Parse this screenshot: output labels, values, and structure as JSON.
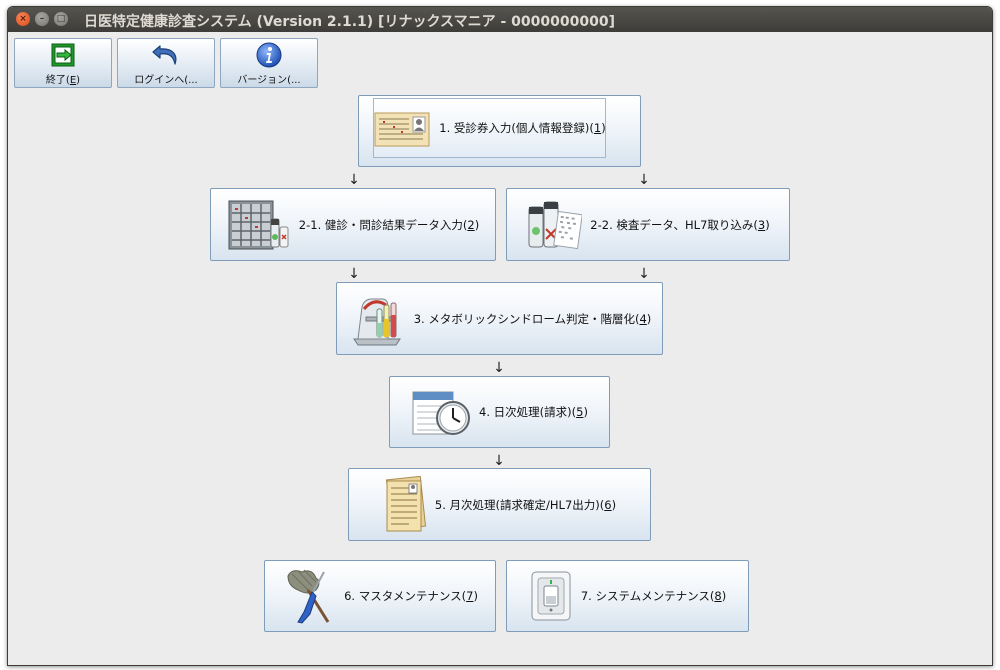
{
  "window": {
    "title": "日医特定健康診査システム (Version 2.1.1) [リナックスマニア - 0000000000]",
    "close_glyph": "×",
    "min_glyph": "–",
    "max_glyph": "□"
  },
  "toolbar": {
    "exit_label": "終了(",
    "exit_key": "E",
    "exit_tail": ")",
    "login_label": "ログインへ(...",
    "version_label": "バージョン(..."
  },
  "menu": {
    "item1": {
      "text": "1. 受診券入力(個人情報登録)(",
      "key": "1",
      "tail": ")"
    },
    "item2_1": {
      "text": "2-1. 健診・問診結果データ入力(",
      "key": "2",
      "tail": ")"
    },
    "item2_2": {
      "text": "2-2. 検査データ、HL7取り込み(",
      "key": "3",
      "tail": ")"
    },
    "item3": {
      "text": "3. メタボリックシンドローム判定・階層化(",
      "key": "4",
      "tail": ")"
    },
    "item4": {
      "text": "4. 日次処理(請求)(",
      "key": "5",
      "tail": ")"
    },
    "item5": {
      "text": "5. 月次処理(請求確定/HL7出力)(",
      "key": "6",
      "tail": ")"
    },
    "item6": {
      "text": "6. マスタメンテナンス(",
      "key": "7",
      "tail": ")"
    },
    "item7": {
      "text": "7. システムメンテナンス(",
      "key": "8",
      "tail": ")"
    }
  },
  "flow_arrow_glyph": "↓",
  "colors": {
    "titlebar": "#3e3d39",
    "close_button": "#dd4814",
    "button_border": "#7f9db9",
    "button_gradient_bottom": "#d8e4ef"
  },
  "icons": {
    "exit": "exit-door-icon",
    "login": "undo-arrow-icon",
    "version": "info-icon",
    "m1": "id-card-icon",
    "m2_1": "medical-records-icon",
    "m2_2": "lab-bottles-icon",
    "m3": "lab-test-tubes-icon",
    "m4": "clock-document-icon",
    "m5": "ledger-paper-icon",
    "m6": "duster-screwdriver-icon",
    "m7": "light-switch-icon"
  }
}
